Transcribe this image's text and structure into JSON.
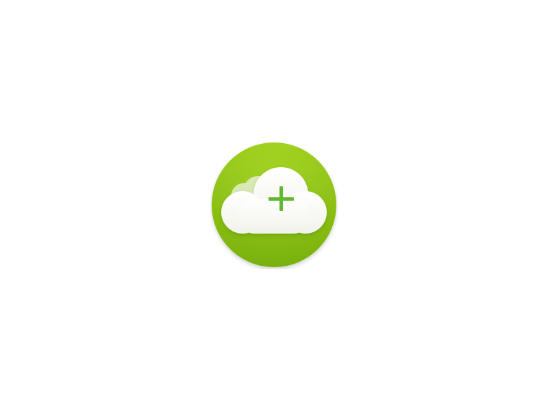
{
  "icon": {
    "name": "cloud-add-icon",
    "colors": {
      "page_background": "#ffffff",
      "circle_light": "#a3d61a",
      "circle_dark": "#7fbb08",
      "cloud_fill": "#fafaf6",
      "cloud_back_fill": "#eef4e4",
      "plus_color": "#62b830"
    }
  }
}
